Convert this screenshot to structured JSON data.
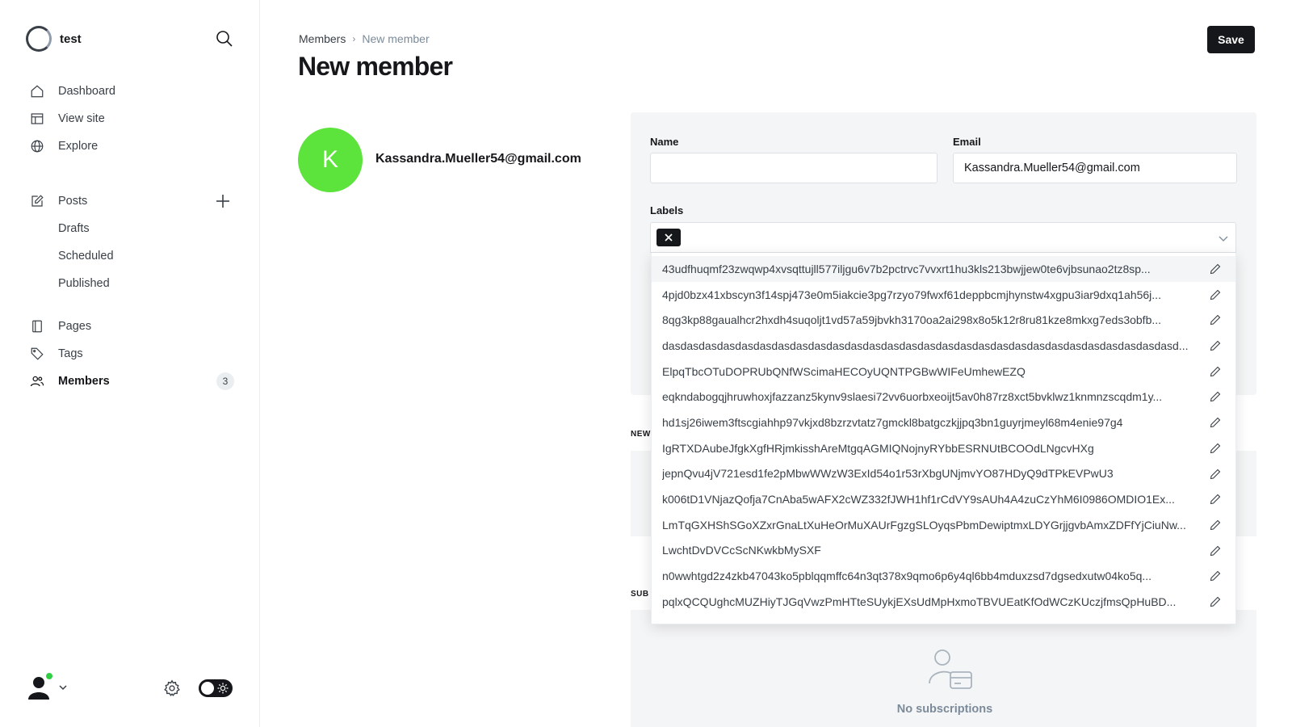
{
  "sidebar": {
    "site_name": "test",
    "nav_primary": [
      {
        "label": "Dashboard"
      },
      {
        "label": "View site"
      },
      {
        "label": "Explore"
      }
    ],
    "posts": {
      "label": "Posts",
      "sub": [
        {
          "label": "Drafts"
        },
        {
          "label": "Scheduled"
        },
        {
          "label": "Published"
        }
      ]
    },
    "nav_secondary": [
      {
        "label": "Pages"
      },
      {
        "label": "Tags"
      },
      {
        "label": "Members",
        "badge": "3"
      }
    ]
  },
  "header": {
    "breadcrumb_parent": "Members",
    "breadcrumb_current": "New member",
    "title": "New member",
    "save_label": "Save"
  },
  "member": {
    "initial": "K",
    "email_display": "Kassandra.Mueller54@gmail.com",
    "avatar_color": "#5ce33c"
  },
  "form": {
    "name_label": "Name",
    "name_value": "",
    "email_label": "Email",
    "email_value": "Kassandra.Mueller54@gmail.com",
    "labels_label": "Labels"
  },
  "sections": {
    "newsletters_head": "NEW",
    "subscriptions_head": "SUB",
    "no_subscriptions": "No subscriptions"
  },
  "labels_options": [
    "43udfhuqmf23zwqwp4xvsqttujll577iljgu6v7b2pctrvc7vvxrt1hu3kls213bwjjew0te6vjbsunao2tz8sp...",
    "4pjd0bzx41xbscyn3f14spj473e0m5iakcie3pg7rzyo79fwxf61deppbcmjhynstw4xgpu3iar9dxq1ah56j...",
    "8qg3kp88gaualhcr2hxdh4suqoljt1vd57a59jbvkh3170oa2ai298x8o5k12r8ru81kze8mkxg7eds3obfb...",
    "dasdasdasdasdasdasdasdasdasdasdasdasdasdasdasdasdasdasdasdasdasdasdasdasdasdasdasdasd...",
    "ElpqTbcOTuDOPRUbQNfWScimaHECOyUQNTPGBwWIFeUmhewEZQ",
    "eqkndabogqjhruwhoxjfazzanz5kynv9slaesi72vv6uorbxeoijt5av0h87rz8xct5bvklwz1knmnzscqdm1y...",
    "hd1sj26iwem3ftscgiahhp97vkjxd8bzrzvtatz7gmckl8batgczkjjpq3bn1guyrjmeyl68m4enie97g4",
    "IgRTXDAubeJfgkXgfHRjmkisshAreMtgqAGMIQNojnyRYbbESRNUtBCOOdLNgcvHXg",
    "jepnQvu4jV721esd1fe2pMbwWWzW3ExId54o1r53rXbgUNjmvYO87HDyQ9dTPkEVPwU3",
    "k006tD1VNjazQofja7CnAba5wAFX2cWZ332fJWH1hf1rCdVY9sAUh4A4zuCzYhM6I0986OMDIO1Ex...",
    "LmTqGXHShSGoXZxrGnaLtXuHeOrMuXAUrFgzgSLOyqsPbmDewiptmxLDYGrjjgvbAmxZDFfYjCiuNw...",
    "LwchtDvDVCcScNKwkbMySXF",
    "n0wwhtgd2z4zkb47043ko5pblqqmffc64n3qt378x9qmo6p6y4ql6bb4mduxzsd7dgsedxutw04ko5q...",
    "pqlxQCQUghcMUZHiyTJGqVwzPmHTteSUykjEXsUdMpHxmoTBVUEatKfOdWCzKUczjfmsQpHuBD..."
  ]
}
